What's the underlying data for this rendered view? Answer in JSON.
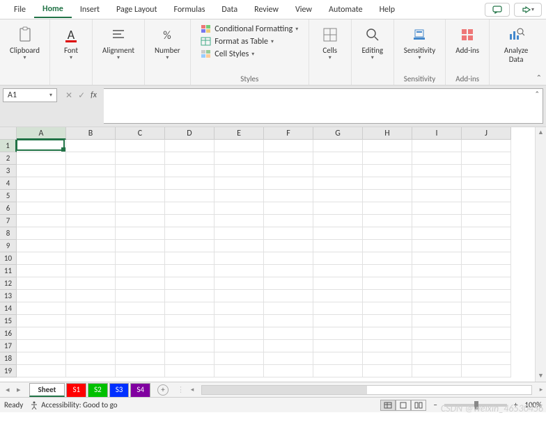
{
  "tabs": [
    "File",
    "Home",
    "Insert",
    "Page Layout",
    "Formulas",
    "Data",
    "Review",
    "View",
    "Automate",
    "Help"
  ],
  "activeTab": "Home",
  "ribbon": {
    "clipboard": {
      "label": "Clipboard"
    },
    "font": {
      "label": "Font"
    },
    "alignment": {
      "label": "Alignment"
    },
    "number": {
      "label": "Number"
    },
    "styles": {
      "label": "Styles",
      "conditional": "Conditional Formatting",
      "table": "Format as Table",
      "cellstyles": "Cell Styles"
    },
    "cells": {
      "label": "Cells"
    },
    "editing": {
      "label": "Editing"
    },
    "sensitivity": {
      "label": "Sensitivity",
      "btn": "Sensitivity"
    },
    "addins": {
      "label": "Add-ins",
      "btn": "Add-ins"
    },
    "analyze": {
      "label": "",
      "btn": "Analyze Data"
    }
  },
  "nameBox": "A1",
  "formula": "",
  "columns": [
    "A",
    "B",
    "C",
    "D",
    "E",
    "F",
    "G",
    "H",
    "I",
    "J"
  ],
  "rows": [
    1,
    2,
    3,
    4,
    5,
    6,
    7,
    8,
    9,
    10,
    11,
    12,
    13,
    14,
    15,
    16,
    17,
    18,
    19
  ],
  "activeCell": {
    "col": "A",
    "row": 1
  },
  "sheets": [
    {
      "name": "Sheet",
      "color": null,
      "active": true
    },
    {
      "name": "S1",
      "color": "#ff0000"
    },
    {
      "name": "S2",
      "color": "#00c000"
    },
    {
      "name": "S3",
      "color": "#0030ff"
    },
    {
      "name": "S4",
      "color": "#8000a0"
    }
  ],
  "status": {
    "ready": "Ready",
    "accessibility": "Accessibility: Good to go",
    "zoom": "100%"
  },
  "watermark": "CSDN @weixin_46530456"
}
